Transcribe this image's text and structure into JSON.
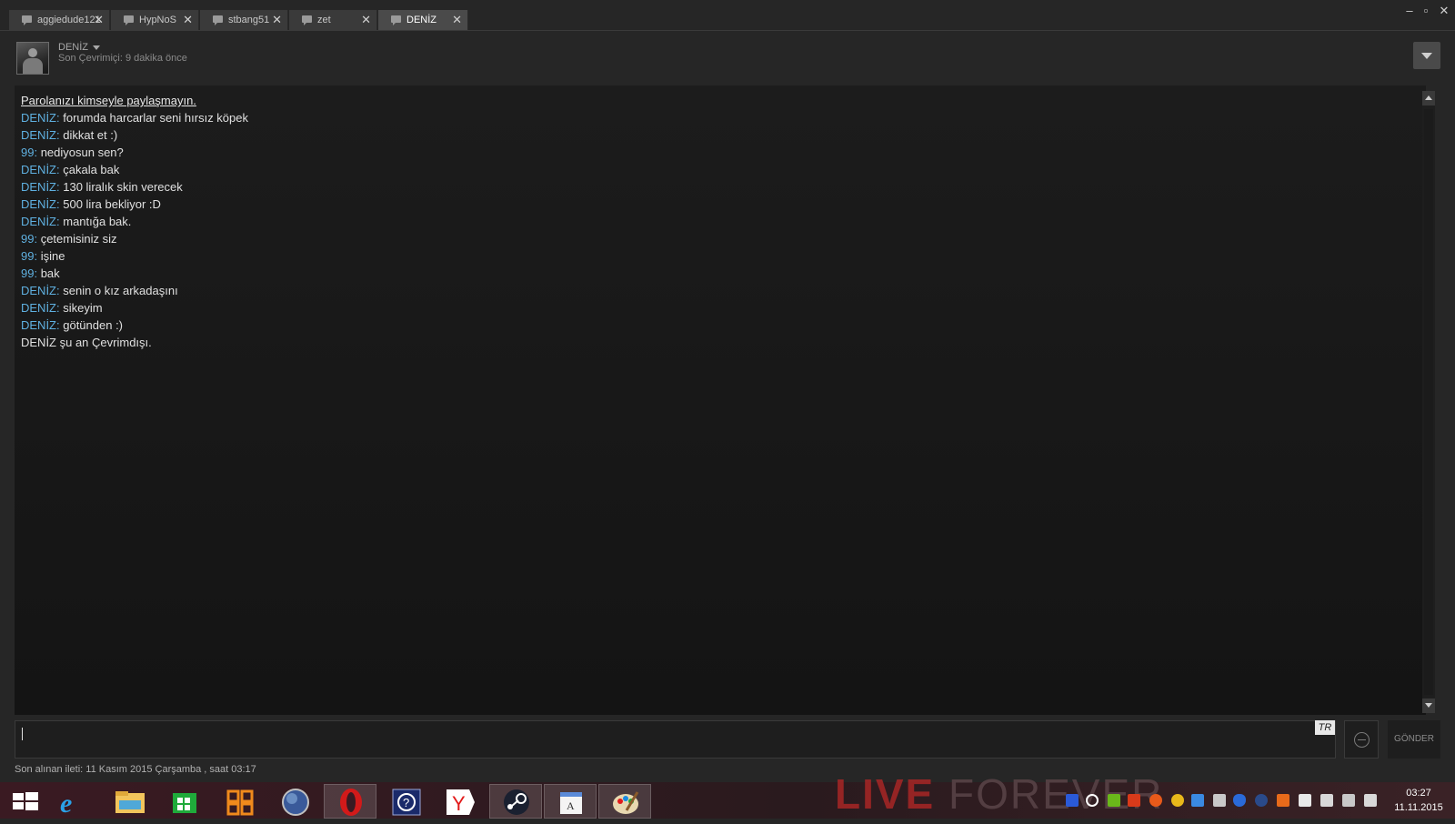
{
  "tabs": [
    {
      "label": "aggiedude121"
    },
    {
      "label": "HypNoS"
    },
    {
      "label": "stbang51"
    },
    {
      "label": "zet"
    },
    {
      "label": "DENİZ"
    }
  ],
  "window_controls": {
    "minimize": "–",
    "restore": "▫",
    "close": "✕"
  },
  "friend": {
    "name": "DENİZ",
    "status": "Son Çevrimiçi: 9 dakika önce"
  },
  "chat": {
    "warning": "Parolanızı kimseyle paylaşmayın.",
    "messages": [
      {
        "sender": "DENİZ:",
        "text": " forumda harcarlar seni hırsız köpek"
      },
      {
        "sender": "DENİZ:",
        "text": " dikkat et :)"
      },
      {
        "sender": "99:",
        "text": " nediyosun sen?"
      },
      {
        "sender": "DENİZ:",
        "text": " çakala bak"
      },
      {
        "sender": "DENİZ:",
        "text": " 130 liralık skin verecek"
      },
      {
        "sender": "DENİZ:",
        "text": " 500 lira bekliyor :D"
      },
      {
        "sender": "DENİZ:",
        "text": " mantığa bak."
      },
      {
        "sender": "99:",
        "text": " çetemisiniz siz"
      },
      {
        "sender": "99:",
        "text": " işine"
      },
      {
        "sender": "99:",
        "text": " bak"
      },
      {
        "sender": "DENİZ:",
        "text": " senin o kız arkadaşını"
      },
      {
        "sender": "DENİZ:",
        "text": " sikeyim"
      },
      {
        "sender": "DENİZ:",
        "text": " götünden :)"
      }
    ],
    "offline_notice": "DENİZ şu an Çevrimdışı."
  },
  "input": {
    "language_badge": "TR",
    "send_label": "GÖNDER",
    "value": ""
  },
  "last_received": "Son alınan ileti: 11 Kasım 2015 Çarşamba , saat 03:17",
  "wallpaper": {
    "text_bold": "LIVE",
    "text_thin": "FOREVER"
  },
  "taskbar": {
    "icons": [
      "windows-start-icon",
      "internet-explorer-icon",
      "file-explorer-icon",
      "store-icon",
      "office-icon",
      "globe-icon",
      "opera-icon",
      "help-icon",
      "yandex-browser-icon",
      "steam-icon",
      "document-viewer-icon",
      "paint-icon"
    ],
    "clock_time": "03:27",
    "clock_date": "11.11.2015"
  },
  "colors": {
    "sender": "#5fb0e0",
    "background": "#262626",
    "chat_bg": "#181818"
  }
}
